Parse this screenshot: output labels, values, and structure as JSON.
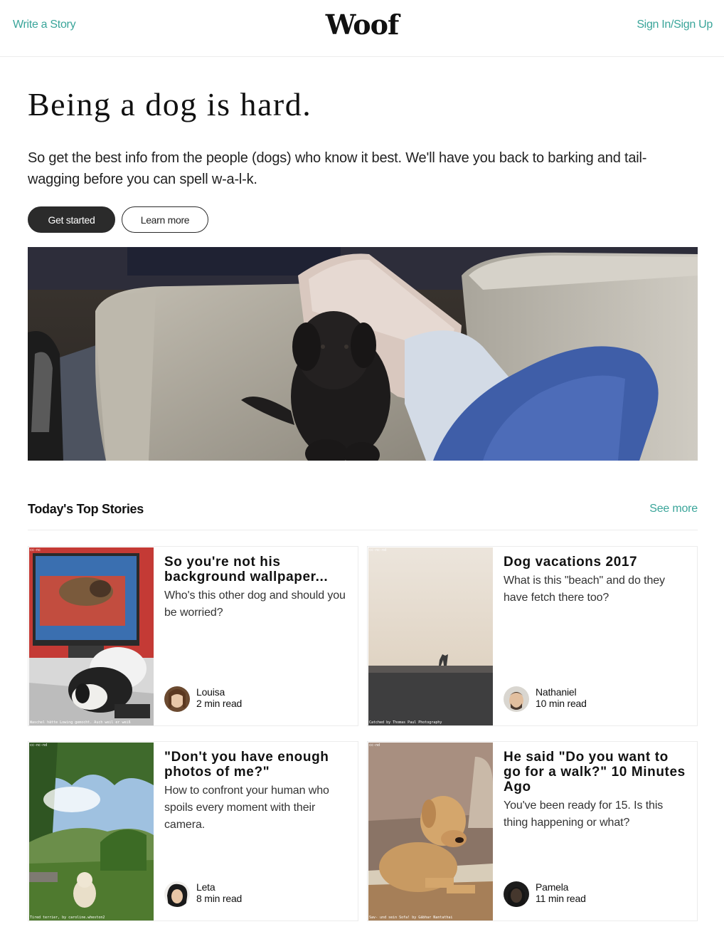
{
  "header": {
    "write_link": "Write a Story",
    "brand": "Woof",
    "auth_link": "Sign In/Sign Up"
  },
  "hero": {
    "title": "Being a dog is hard.",
    "subtitle": "So get the best info from the people (dogs) who know it best. We'll have you back to barking and tail-wagging before you can spell w-a-l-k.",
    "primary_button": "Get started",
    "secondary_button": "Learn more"
  },
  "top_stories": {
    "heading": "Today's Top Stories",
    "see_more": "See more",
    "stories": [
      {
        "title": "So you're not his background wallpaper...",
        "description": "Who's this other dog and should you be worried?",
        "author": "Louisa",
        "read_time": "2 min read",
        "photo_license": "cc-nc",
        "photo_credit": "Waschel hätte Lowing gemocht. Auch weil er weiß"
      },
      {
        "title": "Dog vacations 2017",
        "description": "What is this \"beach\" and do they have fetch there too?",
        "author": "Nathaniel",
        "read_time": "10 min read",
        "photo_license": "cc-nc-nd",
        "photo_credit": "Catched by Thomas Paul Photography"
      },
      {
        "title": "\"Don't you have enough photos of me?\"",
        "description": "How to confront your human who spoils every moment with their camera.",
        "author": "Leta",
        "read_time": "8 min read",
        "photo_license": "cc-nc-nd",
        "photo_credit": "Tired terrier, by caroline.wheston2"
      },
      {
        "title": "He said \"Do you want to go for a walk?\" 10 Minutes Ago",
        "description": "You've been ready for 15. Is this thing happening or what?",
        "author": "Pamela",
        "read_time": "11 min read",
        "photo_license": "cc-nd",
        "photo_credit": "Sav- und sein Sofa! by Gäbhar Nantathai"
      }
    ]
  }
}
